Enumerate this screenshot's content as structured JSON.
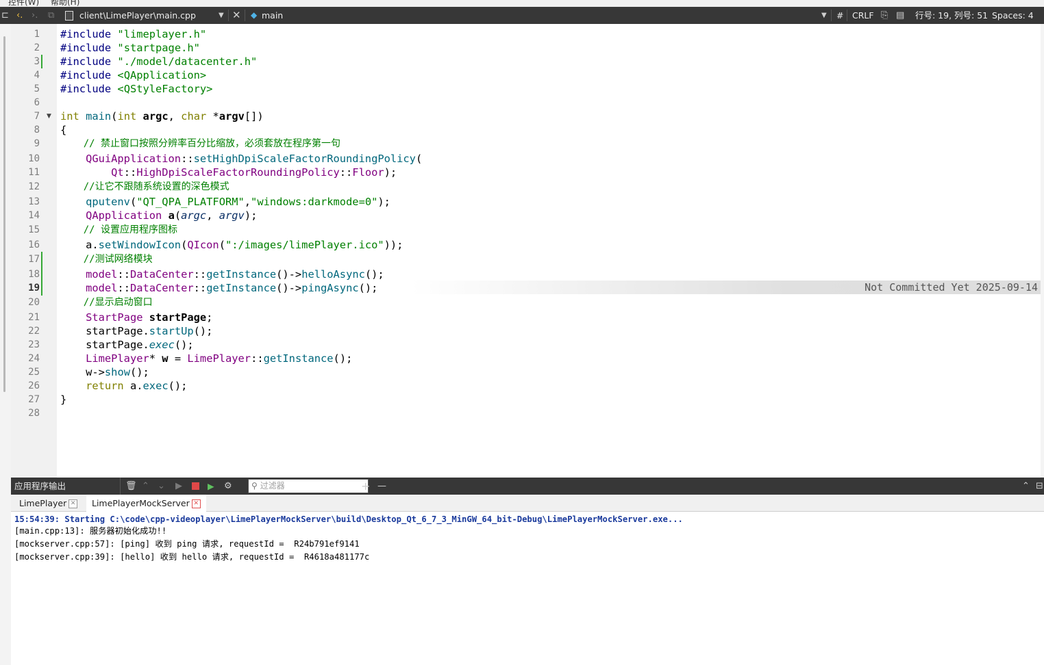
{
  "menu": {
    "items": [
      "控件(W)",
      "帮助(H)"
    ]
  },
  "toolbar": {
    "file_path": "client\\LimePlayer\\main.cpp",
    "symbol": "main",
    "hash_label": "#",
    "line_ending": "CRLF",
    "position": "行号: 19, 列号: 51",
    "indent": "Spaces: 4"
  },
  "editor": {
    "line_numbers": [
      "1",
      "2",
      "3",
      "4",
      "5",
      "6",
      "7",
      "8",
      "9",
      "10",
      "11",
      "12",
      "13",
      "14",
      "15",
      "16",
      "17",
      "18",
      "19",
      "20",
      "21",
      "22",
      "23",
      "24",
      "25",
      "26",
      "27",
      "28"
    ],
    "current_line": "19",
    "blame_text": "Not Committed Yet 2025-09-14",
    "code": {
      "l1a": "#include",
      "l1b": "\"limeplayer.h\"",
      "l2a": "#include",
      "l2b": "\"startpage.h\"",
      "l3a": "#include",
      "l3b": "\"./model/datacenter.h\"",
      "l4a": "#include",
      "l4b": "<QApplication>",
      "l5a": "#include",
      "l5b": "<QStyleFactory>",
      "l7_kw1": "int",
      "l7_fn": "main",
      "l7_kw2": "int",
      "l7_p1": "argc",
      "l7_kw3": "char",
      "l7_p2": "argv",
      "l8": "{",
      "l9": "// 禁止窗口按照分辨率百分比缩放，必须套放在程序第一句",
      "l10_cls": "QGuiApplication",
      "l10_fn": "setHighDpiScaleFactorRoundingPolicy",
      "l11_ns": "Qt",
      "l11_cls": "HighDpiScaleFactorRoundingPolicy",
      "l11_val": "Floor",
      "l12": "//让它不跟随系统设置的深色模式",
      "l13_fn": "qputenv",
      "l13_s1": "\"QT_QPA_PLATFORM\"",
      "l13_s2": "\"windows:darkmode=0\"",
      "l14_cls": "QApplication",
      "l14_var": "a",
      "l14_p1": "argc",
      "l14_p2": "argv",
      "l15": "// 设置应用程序图标",
      "l16_fn": "setWindowIcon",
      "l16_cls": "QIcon",
      "l16_s": "\":/images/limePlayer.ico\"",
      "l17": "//测试网络模块",
      "l18_ns": "model",
      "l18_cls": "DataCenter",
      "l18_fn1": "getInstance",
      "l18_fn2": "helloAsync",
      "l19_ns": "model",
      "l19_cls": "DataCenter",
      "l19_fn1": "getInstance",
      "l19_fn2": "pingAsync",
      "l20": "//显示启动窗口",
      "l21_cls": "StartPage",
      "l21_var": "startPage",
      "l22_obj": "startPage",
      "l22_fn": "startUp",
      "l23_obj": "startPage",
      "l23_fn": "exec",
      "l24_cls": "LimePlayer",
      "l24_var": "w",
      "l24_cls2": "LimePlayer",
      "l24_fn": "getInstance",
      "l25_obj": "w",
      "l25_fn": "show",
      "l26_kw": "return",
      "l26_obj": "a",
      "l26_fn": "exec",
      "l27": "}"
    }
  },
  "output_panel": {
    "title": "应用程序输出",
    "filter_placeholder": "过滤器",
    "plus": "+",
    "minus": "—",
    "tabs": [
      "LimePlayer",
      "LimePlayerMockServer"
    ],
    "lines": [
      "15:54:39: Starting C:\\code\\cpp-videoplayer\\LimePlayerMockServer\\build\\Desktop_Qt_6_7_3_MinGW_64_bit-Debug\\LimePlayerMockServer.exe...",
      "[main.cpp:13]: 服务器初始化成功!!",
      "[mockserver.cpp:57]: [ping] 收到 ping 请求, requestId =  R24b791ef9141",
      "[mockserver.cpp:39]: [hello] 收到 hello 请求, requestId =  R4618a481177c"
    ]
  },
  "colors": {
    "toolbar_bg": "#373737",
    "gutter_bg": "#f1f1f1",
    "vcs_mark": "#34a834",
    "stop_red": "#e04848"
  }
}
